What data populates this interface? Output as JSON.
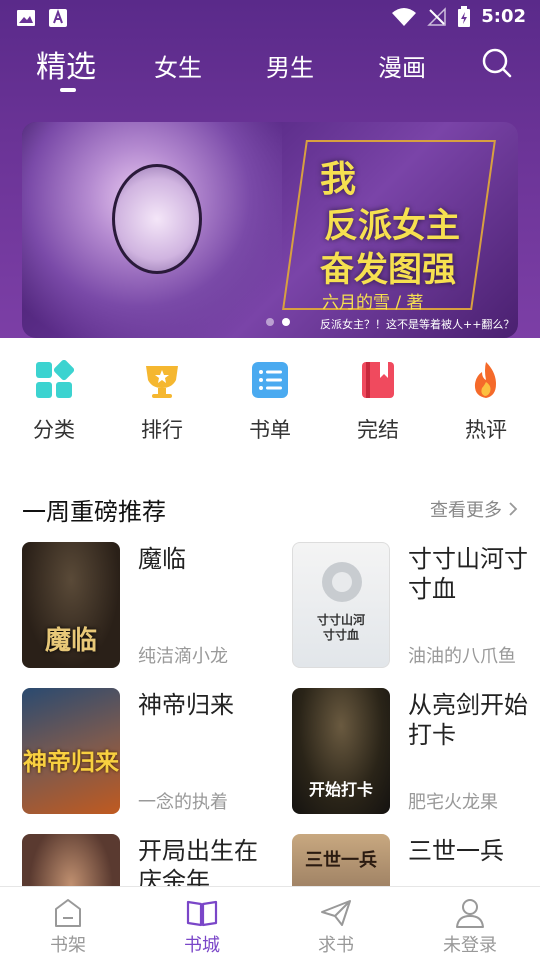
{
  "status_bar": {
    "time": "5:02",
    "icons": [
      "image-icon",
      "text-a-icon",
      "wifi-icon",
      "no-signal-icon",
      "battery-charging-icon"
    ]
  },
  "top_tabs": {
    "items": [
      {
        "label": "精选",
        "active": true
      },
      {
        "label": "女生",
        "active": false
      },
      {
        "label": "男生",
        "active": false
      },
      {
        "label": "漫画",
        "active": false
      }
    ],
    "search_icon": "search-icon"
  },
  "banner": {
    "title_line1": "我",
    "title_line2": "反派女主",
    "title_line3": "奋发图强",
    "author": "六月的雪 / 著",
    "tagline": "反派女主？！这不是等着被人++翻么？",
    "dots": 2,
    "active_dot": 1
  },
  "quick_entries": [
    {
      "label": "分类",
      "icon": "category-grid-icon",
      "color": "#3cd3d0"
    },
    {
      "label": "排行",
      "icon": "trophy-icon",
      "color": "#f5b730"
    },
    {
      "label": "书单",
      "icon": "list-icon",
      "color": "#4aaaf0"
    },
    {
      "label": "完结",
      "icon": "bookmark-book-icon",
      "color": "#f04a5e"
    },
    {
      "label": "热评",
      "icon": "fire-icon",
      "color": "#f56a2a"
    }
  ],
  "section": {
    "title": "一周重磅推荐",
    "more": "查看更多"
  },
  "books": [
    {
      "title": "魔临",
      "author": "纯洁滴小龙",
      "cover_text": "魔临",
      "cover_colors": [
        "#2a2018",
        "#6a4a28"
      ]
    },
    {
      "title": "寸寸山河寸寸血",
      "author": "油油的八爪鱼",
      "cover_text": "寸寸山河\n寸寸血",
      "cover_colors": [
        "#f2f2f2",
        "#d8dce0"
      ]
    },
    {
      "title": "神帝归来",
      "author": "一念的执着",
      "cover_text": "神帝归来",
      "cover_colors": [
        "#1a3a5a",
        "#8a3a20"
      ]
    },
    {
      "title": "从亮剑开始打卡",
      "author": "肥宅火龙果",
      "cover_text": "开始打卡",
      "cover_colors": [
        "#3a3020",
        "#1a1a18"
      ]
    },
    {
      "title": "开局出生在庆余年",
      "author": "",
      "cover_text": "",
      "cover_colors": [
        "#5a3a30",
        "#a07a60"
      ]
    },
    {
      "title": "三世一兵",
      "author": "",
      "cover_text": "三世一兵",
      "cover_colors": [
        "#6a5040",
        "#c0a080"
      ]
    }
  ],
  "bottom_nav": [
    {
      "label": "书架",
      "icon": "bookshelf-icon",
      "active": false
    },
    {
      "label": "书城",
      "icon": "open-book-icon",
      "active": true
    },
    {
      "label": "求书",
      "icon": "paper-plane-icon",
      "active": false
    },
    {
      "label": "未登录",
      "icon": "user-icon",
      "active": false
    }
  ],
  "colors": {
    "header_purple": "#6a3396",
    "active_nav": "#7a46c8",
    "muted_text": "#999999"
  }
}
